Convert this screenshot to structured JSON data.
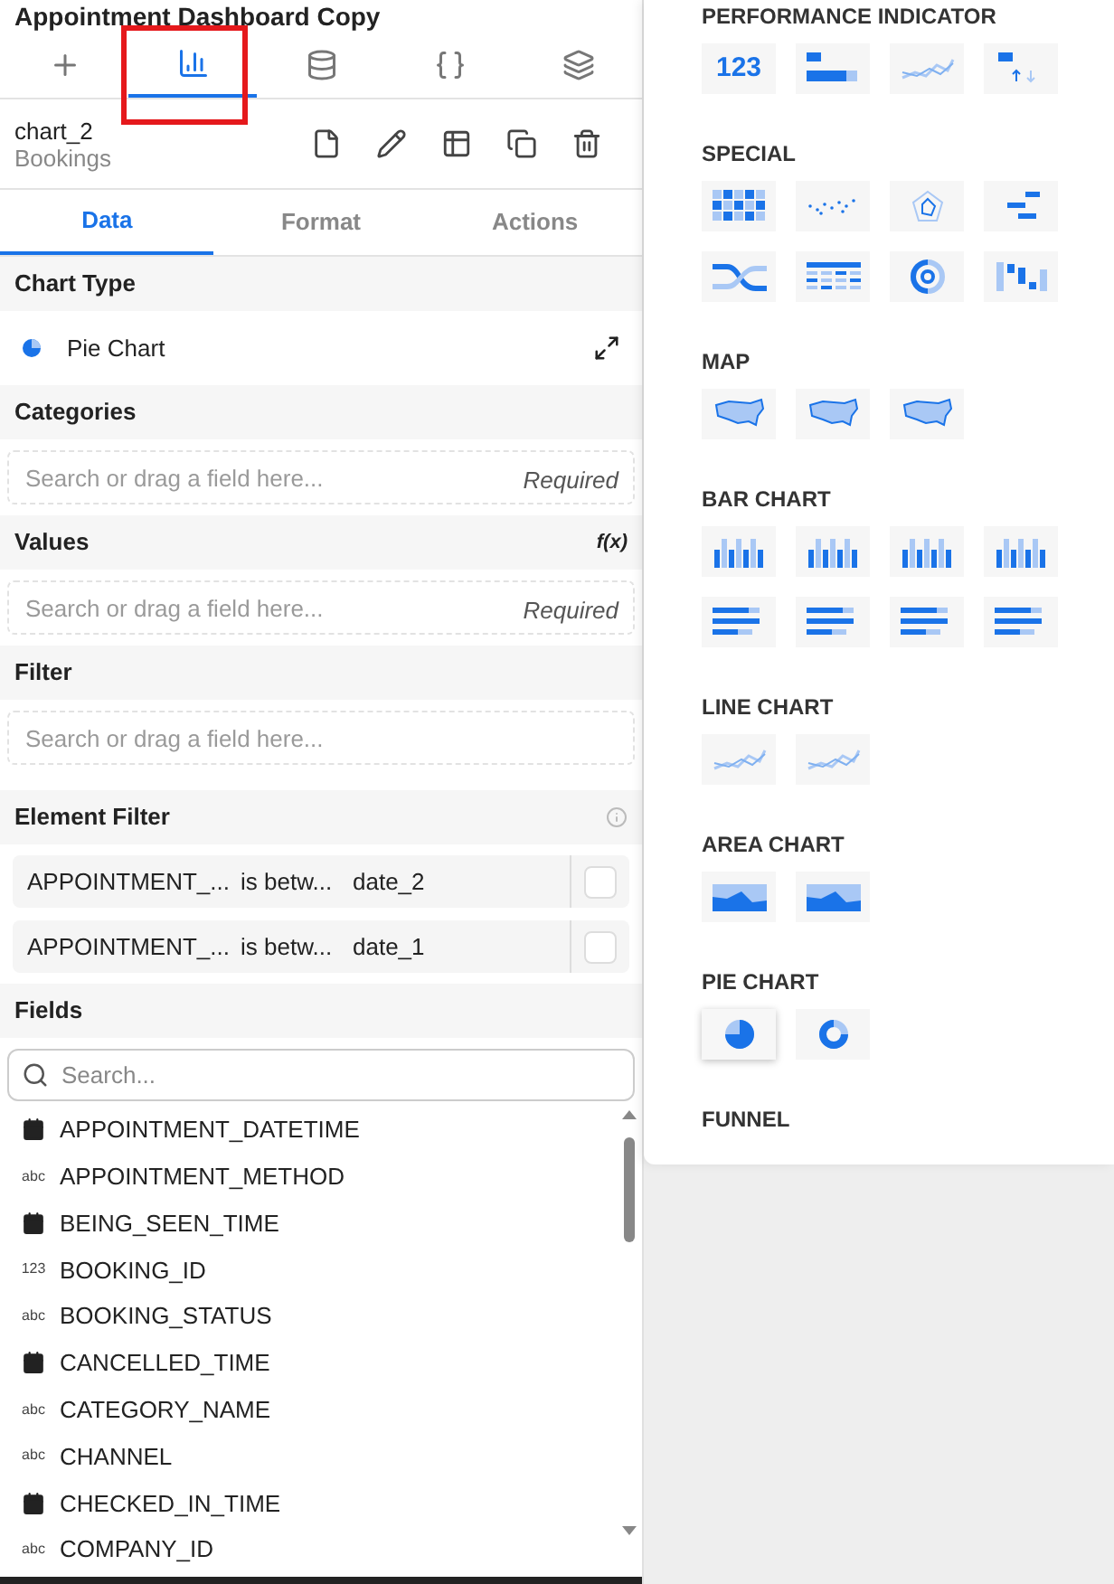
{
  "window": {
    "title": "Appointment Dashboard Copy"
  },
  "top_tabs": [
    {
      "kind": "add",
      "selected": false
    },
    {
      "kind": "chart",
      "selected": true
    },
    {
      "kind": "database",
      "selected": false
    },
    {
      "kind": "code",
      "selected": false
    },
    {
      "kind": "layers",
      "selected": false
    }
  ],
  "element": {
    "name": "chart_2",
    "subtitle": "Bookings",
    "actions": [
      {
        "kind": "page"
      },
      {
        "kind": "edit"
      },
      {
        "kind": "table"
      },
      {
        "kind": "copy"
      },
      {
        "kind": "delete"
      }
    ]
  },
  "tabs": [
    {
      "label": "Data",
      "selected": true
    },
    {
      "label": "Format",
      "selected": false
    },
    {
      "label": "Actions",
      "selected": false
    }
  ],
  "chart_type": {
    "heading": "Chart Type",
    "value": "Pie Chart"
  },
  "categories": {
    "heading": "Categories",
    "placeholder": "Search or drag a field here...",
    "note": "Required"
  },
  "values": {
    "heading": "Values",
    "formula": "f(x)",
    "placeholder": "Search or drag a field here...",
    "note": "Required"
  },
  "filter": {
    "heading": "Filter",
    "placeholder": "Search or drag a field here..."
  },
  "element_filter": {
    "heading": "Element Filter",
    "rows": [
      {
        "field": "APPOINTMENT_...",
        "operator": "is betw...",
        "value": "date_2",
        "checked": false
      },
      {
        "field": "APPOINTMENT_...",
        "operator": "is betw...",
        "value": "date_1",
        "checked": false
      }
    ]
  },
  "fields": {
    "heading": "Fields",
    "placeholder": "Search...",
    "items": [
      {
        "kind": "date",
        "name": "APPOINTMENT_DATETIME"
      },
      {
        "kind": "text",
        "type_label": "abc",
        "name": "APPOINTMENT_METHOD"
      },
      {
        "kind": "date",
        "name": "BEING_SEEN_TIME"
      },
      {
        "kind": "number",
        "type_label": "123",
        "name": "BOOKING_ID"
      },
      {
        "kind": "text",
        "type_label": "abc",
        "name": "BOOKING_STATUS"
      },
      {
        "kind": "date",
        "name": "CANCELLED_TIME"
      },
      {
        "kind": "text",
        "type_label": "abc",
        "name": "CATEGORY_NAME"
      },
      {
        "kind": "text",
        "type_label": "abc",
        "name": "CHANNEL"
      },
      {
        "kind": "date",
        "name": "CHECKED_IN_TIME"
      },
      {
        "kind": "text",
        "type_label": "abc",
        "name": "COMPANY_ID"
      }
    ]
  },
  "gallery": [
    {
      "title": "PERFORMANCE INDICATOR",
      "items": [
        {
          "kind": "number",
          "label": "123",
          "selected": false
        },
        {
          "kind": "progress",
          "selected": false
        },
        {
          "kind": "line",
          "selected": false
        },
        {
          "kind": "arrows",
          "selected": false
        }
      ]
    },
    {
      "title": "SPECIAL",
      "items": [
        {
          "kind": "grid",
          "selected": false
        },
        {
          "kind": "dots",
          "selected": false
        },
        {
          "kind": "radar",
          "selected": false
        },
        {
          "kind": "gantt",
          "selected": false
        },
        {
          "kind": "flow",
          "selected": false
        },
        {
          "kind": "table",
          "selected": false
        },
        {
          "kind": "rings",
          "selected": false
        },
        {
          "kind": "waterfall",
          "selected": false
        }
      ]
    },
    {
      "title": "MAP",
      "items": [
        {
          "kind": "map",
          "selected": false
        },
        {
          "kind": "map",
          "selected": false
        },
        {
          "kind": "map",
          "selected": false
        }
      ]
    },
    {
      "title": "BAR CHART",
      "items": [
        {
          "kind": "bars",
          "selected": false
        },
        {
          "kind": "bars",
          "selected": false
        },
        {
          "kind": "bars",
          "selected": false
        },
        {
          "kind": "bars",
          "selected": false
        },
        {
          "kind": "hbars",
          "selected": false
        },
        {
          "kind": "hbars",
          "selected": false
        },
        {
          "kind": "hbars",
          "selected": false
        },
        {
          "kind": "hbars",
          "selected": false
        }
      ]
    },
    {
      "title": "LINE CHART",
      "items": [
        {
          "kind": "line",
          "selected": false
        },
        {
          "kind": "line",
          "selected": false
        }
      ]
    },
    {
      "title": "AREA CHART",
      "items": [
        {
          "kind": "area",
          "selected": false
        },
        {
          "kind": "area",
          "selected": false
        }
      ]
    },
    {
      "title": "PIE CHART",
      "items": [
        {
          "kind": "pie",
          "selected": true
        },
        {
          "kind": "donut",
          "selected": false
        }
      ]
    },
    {
      "title": "FUNNEL"
    }
  ]
}
